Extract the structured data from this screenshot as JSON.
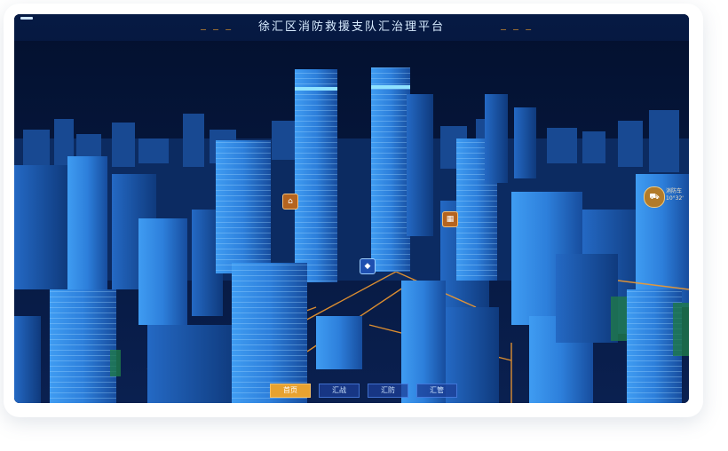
{
  "header": {
    "title": "徐汇区消防救援支队汇治理平台",
    "dashes_left": "— — —",
    "dashes_right": "— — —"
  },
  "nav": [
    {
      "label": "首页",
      "active": true
    },
    {
      "label": "汇战",
      "active": false
    },
    {
      "label": "汇防",
      "active": false
    },
    {
      "label": "汇管",
      "active": false
    }
  ],
  "markers": {
    "vehicle_label": "消防车",
    "vehicle_value": "10°32'"
  },
  "icons": [
    "menu-icon",
    "fire-station-icon",
    "shield-icon",
    "building-icon",
    "fire-truck-icon"
  ],
  "colors": {
    "background": "#04112c",
    "building": "#2b7fe0",
    "road": "#f29a2e",
    "accent": "#e7a230"
  }
}
